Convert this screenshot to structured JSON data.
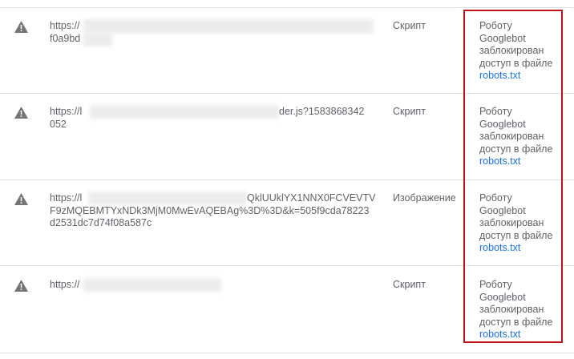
{
  "rows": [
    {
      "icon": "warning-icon",
      "url_lines": [
        "https://",
        "f0a9bd"
      ],
      "type": "Скрипт",
      "status_lines": [
        "Роботу",
        "Googlebot",
        "заблокирован",
        "доступ в файле"
      ],
      "status_link": "robots.txt"
    },
    {
      "icon": "warning-icon",
      "url_lines": [
        "https://l",
        "der.js?1583868342",
        "052"
      ],
      "type": "Скрипт",
      "status_lines": [
        "Роботу",
        "Googlebot",
        "заблокирован",
        "доступ в файле"
      ],
      "status_link": "robots.txt"
    },
    {
      "icon": "warning-icon",
      "url_lines": [
        "https://l",
        "QklUUklYX1NNX0FCVEVTV",
        "F9zMQEBMTYxNDk3MjM0MwEvAQEBAg%3D%3D&k=505f9cda78223",
        "d2531dc7d74f08a587c"
      ],
      "type": "Изображение",
      "status_lines": [
        "Роботу",
        "Googlebot",
        "заблокирован",
        "доступ в файле"
      ],
      "status_link": "robots.txt"
    },
    {
      "icon": "warning-icon",
      "url_lines": [
        "https://"
      ],
      "type": "Скрипт",
      "status_lines": [
        "Роботу",
        "Googlebot",
        "заблокирован",
        "доступ в файле"
      ],
      "status_link": "robots.txt"
    }
  ],
  "colors": {
    "highlight_border": "#c6131b",
    "link": "#1a73e8",
    "text": "#5f6368",
    "divider": "#e0e0e0"
  }
}
